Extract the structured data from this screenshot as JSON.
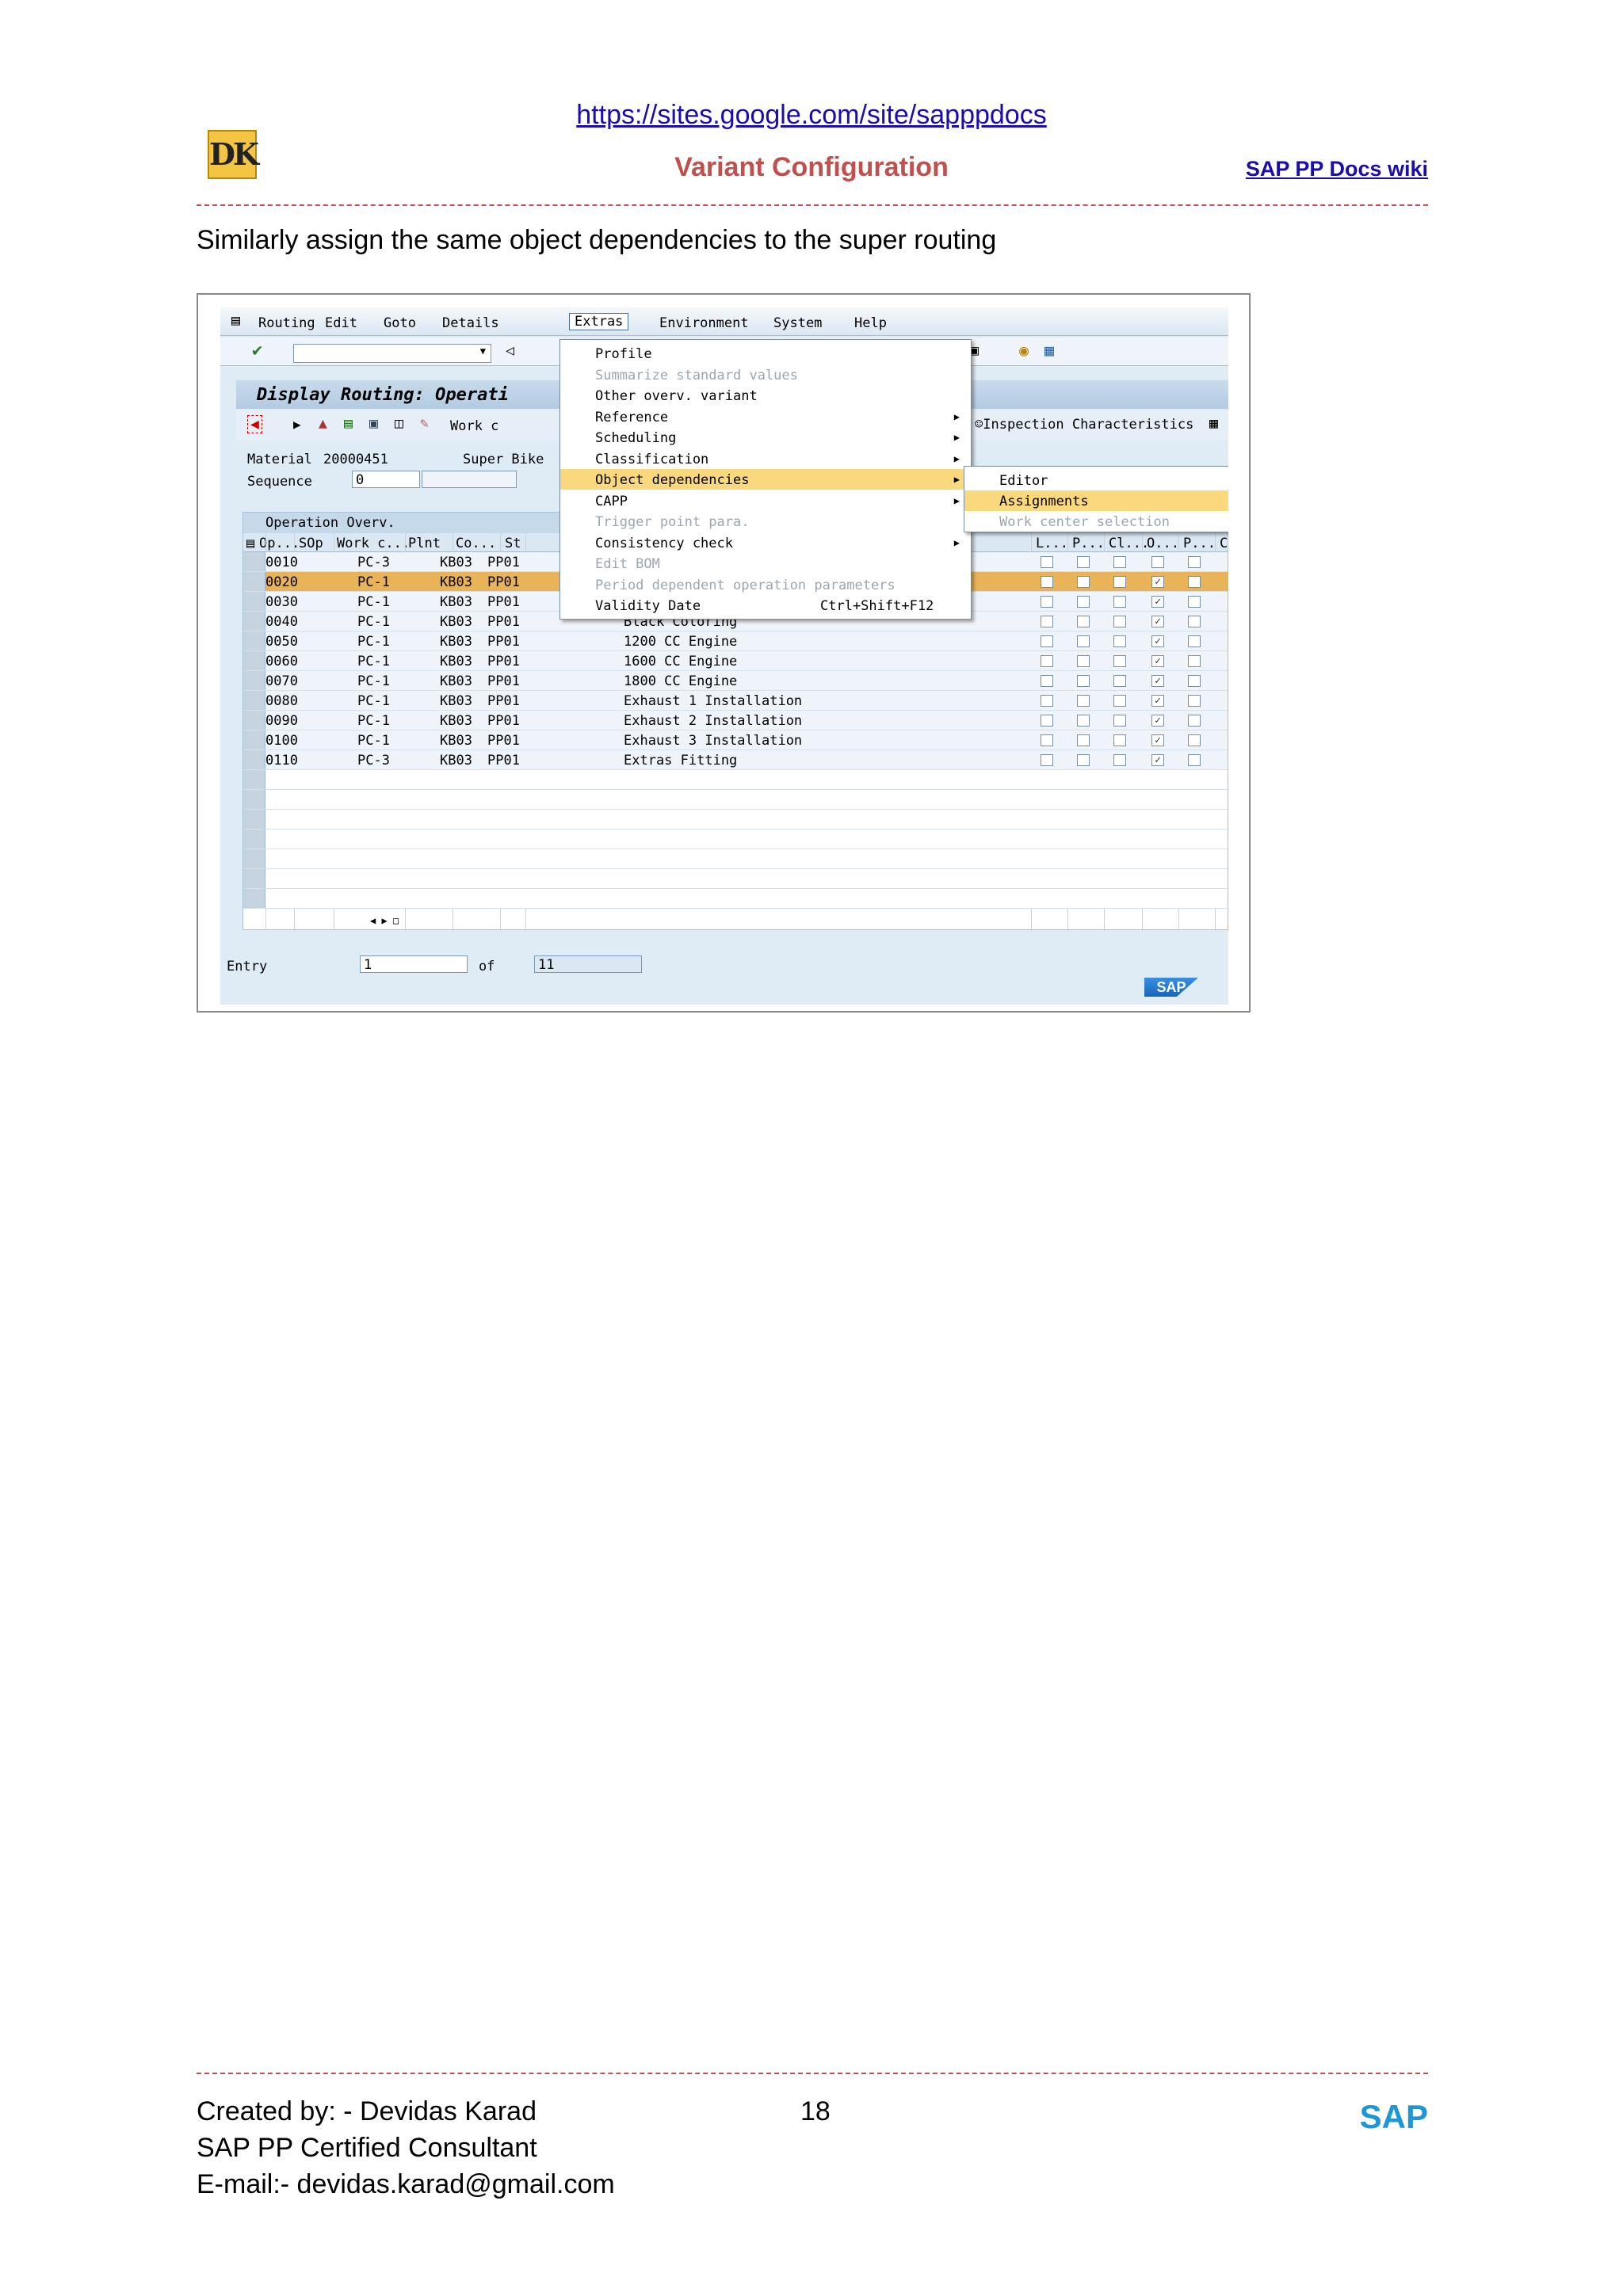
{
  "header": {
    "url": "https://sites.google.com/site/sapppdocs",
    "logo_text": "DK",
    "title": "Variant Configuration",
    "wiki_link": "SAP PP Docs wiki"
  },
  "intro_text": "Similarly assign the same object dependencies to the super routing",
  "sap": {
    "menu": [
      "Routing",
      "Edit",
      "Goto",
      "Details",
      "Extras",
      "Environment",
      "System",
      "Help"
    ],
    "screen_title": "Display Routing: Operati",
    "toolbar_work_label": "Work c",
    "inspection_label": "Inspection Characteristics",
    "material_label": "Material",
    "material_value": "20000451",
    "material_desc": "Super Bike",
    "sequence_label": "Sequence",
    "sequence_value": "0",
    "grid_title": "Operation Overv.",
    "columns": [
      "Op...",
      "SOp",
      "Work c...",
      "Plnt",
      "Co...",
      "St",
      "L...",
      "P...",
      "Cl...",
      "O...",
      "P...",
      "C"
    ],
    "rows": [
      {
        "op": "0010",
        "wc": "PC-3",
        "plnt": "KB03",
        "co": "PP01",
        "desc": "",
        "o": false
      },
      {
        "op": "0020",
        "wc": "PC-1",
        "plnt": "KB03",
        "co": "PP01",
        "desc": "",
        "o": true
      },
      {
        "op": "0030",
        "wc": "PC-1",
        "plnt": "KB03",
        "co": "PP01",
        "desc": "",
        "o": true
      },
      {
        "op": "0040",
        "wc": "PC-1",
        "plnt": "KB03",
        "co": "PP01",
        "desc": "Black Coloring",
        "o": true
      },
      {
        "op": "0050",
        "wc": "PC-1",
        "plnt": "KB03",
        "co": "PP01",
        "desc": "1200 CC Engine",
        "o": true
      },
      {
        "op": "0060",
        "wc": "PC-1",
        "plnt": "KB03",
        "co": "PP01",
        "desc": "1600 CC Engine",
        "o": true
      },
      {
        "op": "0070",
        "wc": "PC-1",
        "plnt": "KB03",
        "co": "PP01",
        "desc": "1800 CC Engine",
        "o": true
      },
      {
        "op": "0080",
        "wc": "PC-1",
        "plnt": "KB03",
        "co": "PP01",
        "desc": "Exhaust 1 Installation",
        "o": true
      },
      {
        "op": "0090",
        "wc": "PC-1",
        "plnt": "KB03",
        "co": "PP01",
        "desc": "Exhaust 2 Installation",
        "o": true
      },
      {
        "op": "0100",
        "wc": "PC-1",
        "plnt": "KB03",
        "co": "PP01",
        "desc": "Exhaust 3 Installation",
        "o": true
      },
      {
        "op": "0110",
        "wc": "PC-3",
        "plnt": "KB03",
        "co": "PP01",
        "desc": "Extras Fitting",
        "o": true
      }
    ],
    "extras_menu": [
      {
        "label": "Profile",
        "disabled": false,
        "arrow": false
      },
      {
        "label": "Summarize standard values",
        "disabled": true,
        "arrow": false
      },
      {
        "label": "Other overv. variant",
        "disabled": false,
        "arrow": false
      },
      {
        "label": "Reference",
        "disabled": false,
        "arrow": true
      },
      {
        "label": "Scheduling",
        "disabled": false,
        "arrow": true
      },
      {
        "label": "Classification",
        "disabled": false,
        "arrow": true
      },
      {
        "label": "Object dependencies",
        "disabled": false,
        "arrow": true,
        "highlight": true
      },
      {
        "label": "CAPP",
        "disabled": false,
        "arrow": true
      },
      {
        "label": "Trigger point para.",
        "disabled": true,
        "arrow": false
      },
      {
        "label": "Consistency check",
        "disabled": false,
        "arrow": true
      },
      {
        "label": "Edit BOM",
        "disabled": true,
        "arrow": false
      },
      {
        "label": "Period dependent operation parameters",
        "disabled": true,
        "arrow": false
      },
      {
        "label": "Validity Date",
        "disabled": false,
        "arrow": false,
        "shortcut": "Ctrl+Shift+F12"
      }
    ],
    "sub_menu": [
      {
        "label": "Editor",
        "disabled": false
      },
      {
        "label": "Assignments",
        "disabled": false,
        "highlight": true
      },
      {
        "label": "Work center selection",
        "disabled": true
      }
    ],
    "entry_label": "Entry",
    "entry_value": "1",
    "of_label": "of",
    "of_value": "11",
    "sap_logo": "SAP"
  },
  "footer": {
    "created_by": "Created by: - Devidas Karad",
    "page_number": "18",
    "certification": "SAP PP Certified Consultant",
    "email": "E-mail:- devidas.karad@gmail.com",
    "brand": "SAP"
  }
}
